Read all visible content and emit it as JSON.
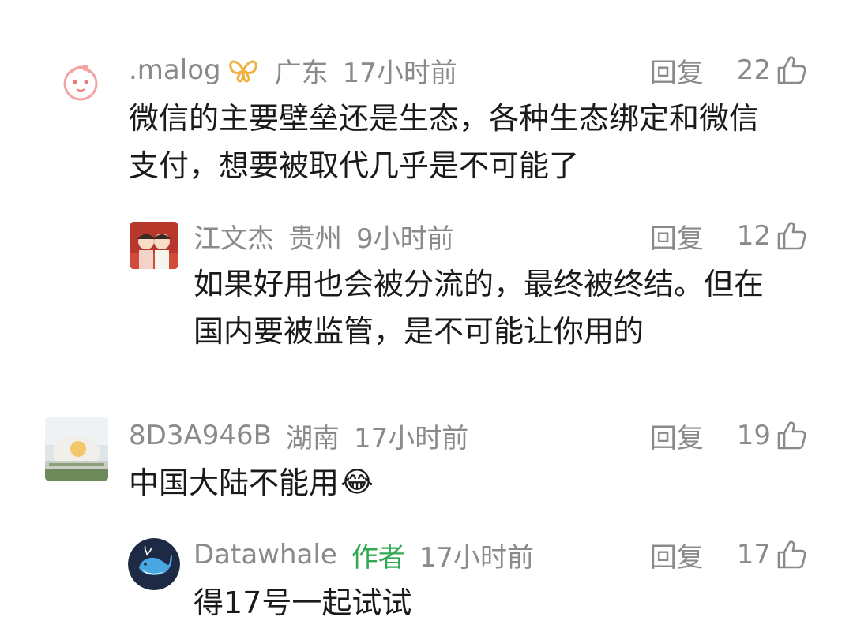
{
  "comments": [
    {
      "user": ".malog",
      "badge_icon": "butterfly-badge-icon",
      "location": "广东",
      "time": "17小时前",
      "reply_label": "回复",
      "likes": "22",
      "text_lines": [
        "微信的主要壁垒还是生态，各种生态绑定和微信",
        "支付，想要被取代几乎是不可能了"
      ],
      "avatar": "baby-face-avatar"
    },
    {
      "user": "江文杰",
      "location": "贵州",
      "time": "9小时前",
      "reply_label": "回复",
      "likes": "12",
      "text_lines": [
        "如果好用也会被分流的，最终被终结。但在",
        "国内要被监管，是不可能让你用的"
      ],
      "avatar": "couple-cartoon-avatar"
    },
    {
      "user": "8D3A946B",
      "location": "湖南",
      "time": "17小时前",
      "reply_label": "回复",
      "likes": "19",
      "text_lines": [
        "中国大陆不能用"
      ],
      "emoji": "😂",
      "avatar": "building-photo-avatar"
    },
    {
      "user": "Datawhale",
      "author_tag": "作者",
      "time": "17小时前",
      "reply_label": "回复",
      "likes": "17",
      "text_lines": [
        "得17号一起试试"
      ],
      "avatar": "whale-logo-avatar"
    }
  ],
  "colors": {
    "meta": "#8a8a8a",
    "text": "#1a1a1a",
    "author_tag": "#32a852"
  }
}
